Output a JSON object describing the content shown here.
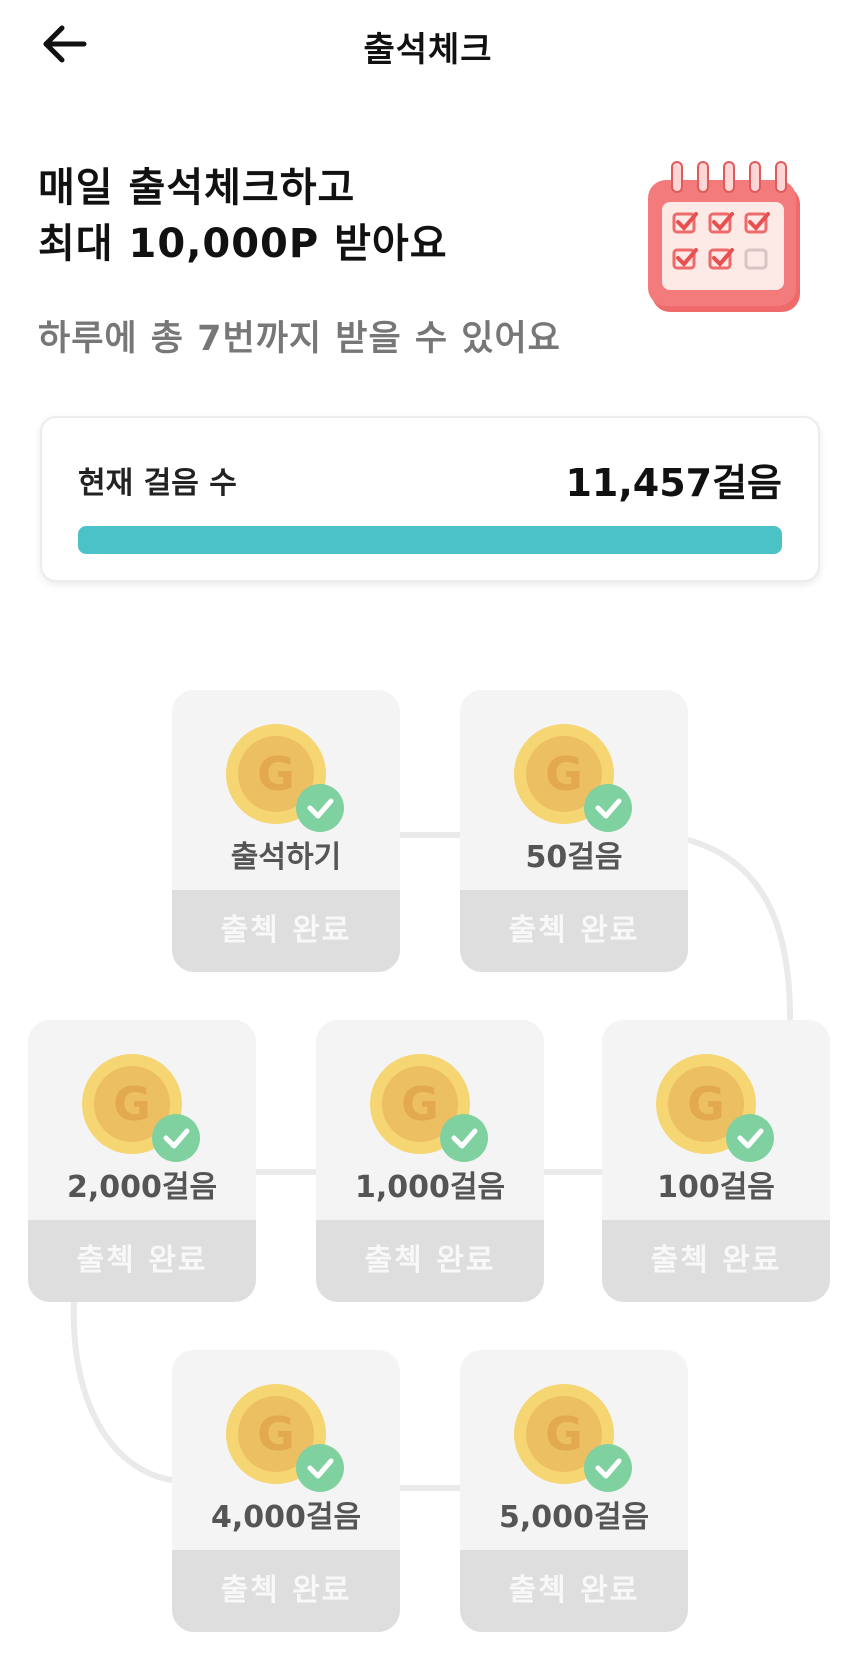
{
  "header": {
    "title": "출석체크"
  },
  "hero": {
    "line1": "매일 출석체크하고",
    "line2": "최대 10,000P 받아요",
    "subtitle": "하루에 총 7번까지 받을 수 있어요"
  },
  "steps": {
    "label": "현재 걸음 수",
    "value": "11,457걸음",
    "progress_percent": 100,
    "progress_color": "#4bc3c6"
  },
  "colors": {
    "coin": "#f6d573",
    "check_badge": "#7fd1a0",
    "tile_bg": "#f4f4f4",
    "tile_status_bg": "#dedede"
  },
  "rewards": [
    {
      "label": "출석하기",
      "status": "출첵 완료",
      "icon": "coin-g-icon",
      "checked": true
    },
    {
      "label": "50걸음",
      "status": "출첵 완료",
      "icon": "coin-g-icon",
      "checked": true
    },
    {
      "label": "100걸음",
      "status": "출첵 완료",
      "icon": "coin-g-icon",
      "checked": true
    },
    {
      "label": "1,000걸음",
      "status": "출첵 완료",
      "icon": "coin-g-icon",
      "checked": true
    },
    {
      "label": "2,000걸음",
      "status": "출첵 완료",
      "icon": "coin-g-icon",
      "checked": true
    },
    {
      "label": "4,000걸음",
      "status": "출첵 완료",
      "icon": "coin-g-icon",
      "checked": true
    },
    {
      "label": "5,000걸음",
      "status": "출첵 완료",
      "icon": "coin-g-icon",
      "checked": true
    }
  ]
}
